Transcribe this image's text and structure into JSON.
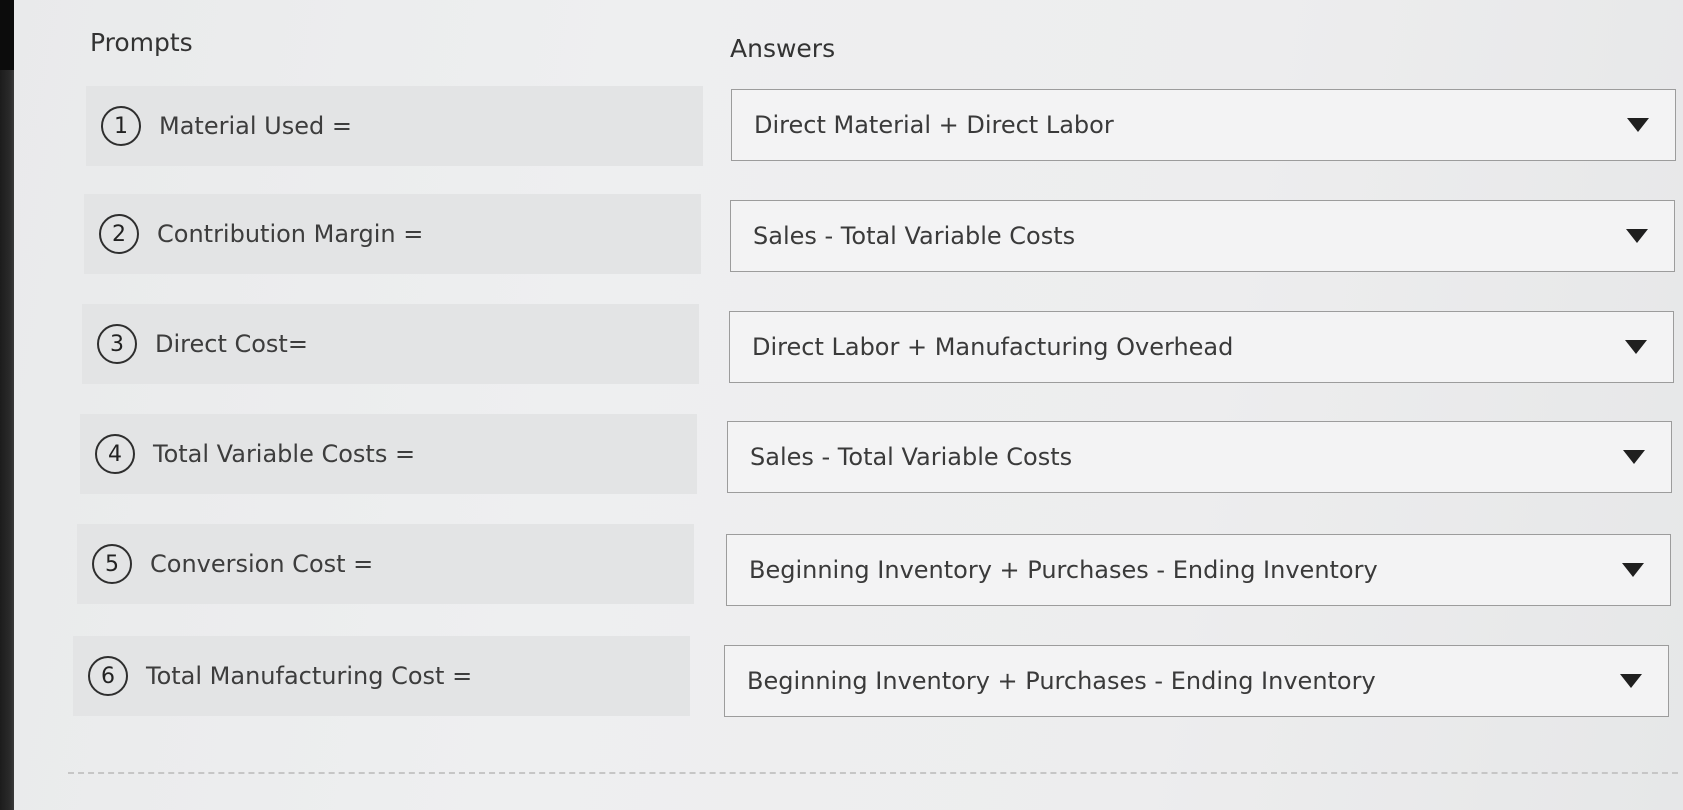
{
  "headers": {
    "prompts": "Prompts",
    "answers": "Answers"
  },
  "rows": [
    {
      "number": "1",
      "prompt": "Material Used =",
      "answer": "Direct Material + Direct Labor"
    },
    {
      "number": "2",
      "prompt": "Contribution Margin =",
      "answer": "Sales - Total Variable Costs"
    },
    {
      "number": "3",
      "prompt": "Direct Cost=",
      "answer": "Direct Labor + Manufacturing Overhead"
    },
    {
      "number": "4",
      "prompt": "Total Variable Costs =",
      "answer": "Sales - Total Variable Costs"
    },
    {
      "number": "5",
      "prompt": "Conversion Cost =",
      "answer": "Beginning Inventory + Purchases - Ending Inventory"
    },
    {
      "number": "6",
      "prompt": "Total Manufacturing Cost =",
      "answer": "Beginning Inventory + Purchases - Ending Inventory"
    }
  ],
  "icons": {
    "dropdown": "caret-down-icon"
  }
}
